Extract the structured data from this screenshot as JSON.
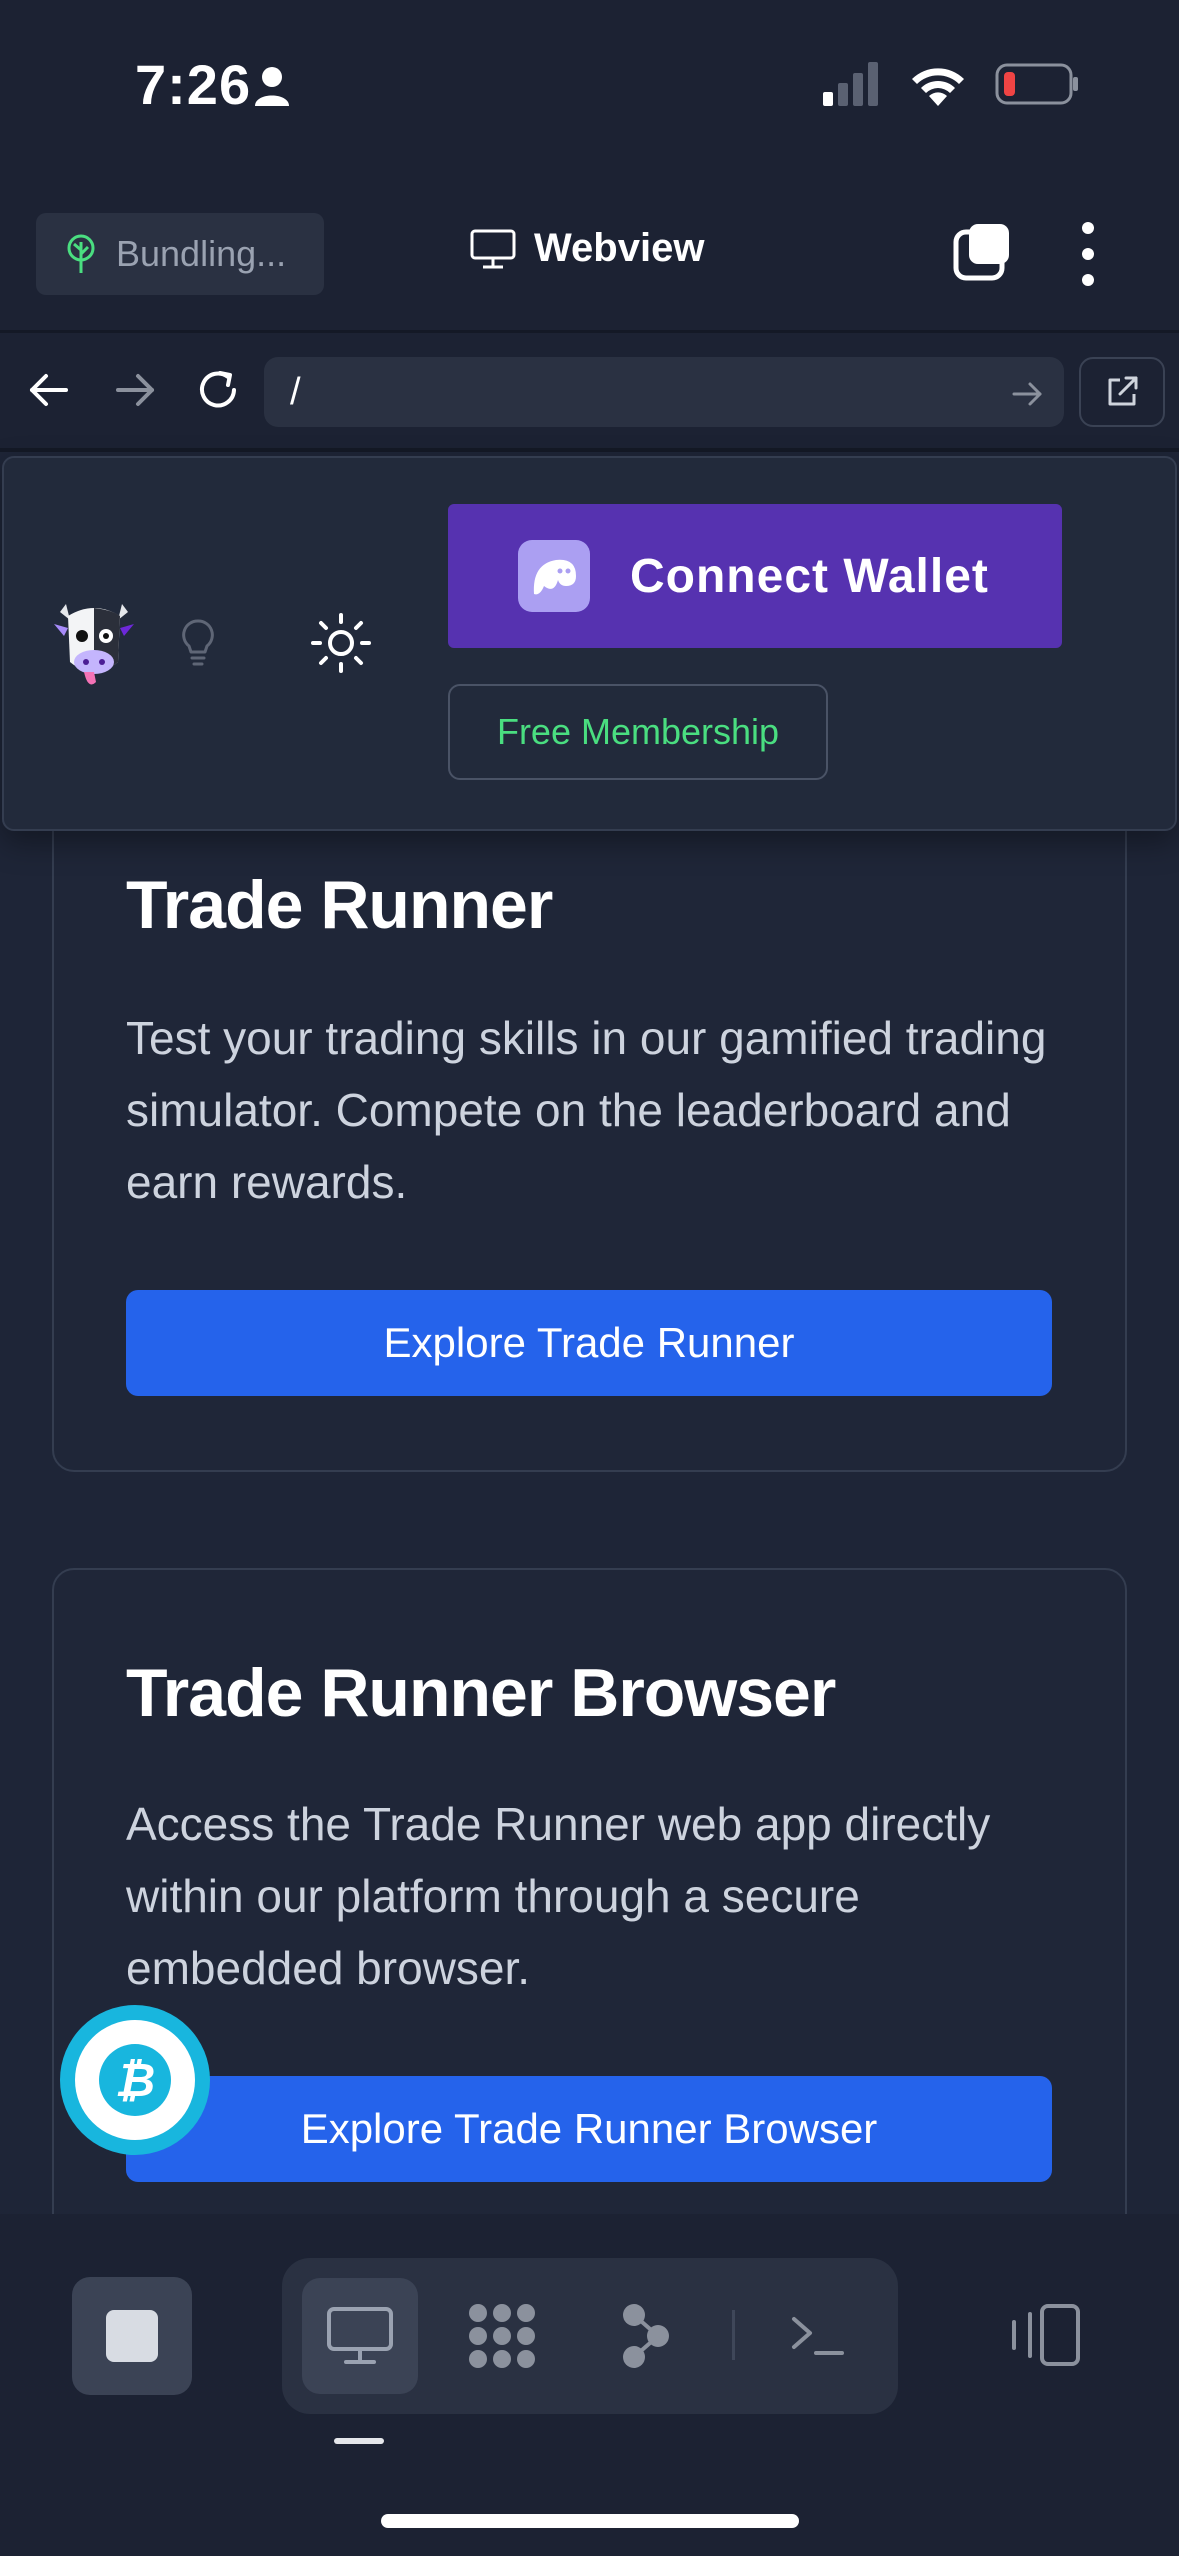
{
  "status_bar": {
    "time": "7:26"
  },
  "toolbar": {
    "bundling_label": "Bundling...",
    "title": "Webview"
  },
  "url_bar": {
    "value": "/"
  },
  "header": {
    "connect_wallet_label": "Connect Wallet",
    "free_membership_label": "Free Membership"
  },
  "cards": [
    {
      "title": "Trade Runner",
      "description": "Test your trading skills in our gamified trading simulator. Compete on the leaderboard and earn rewards.",
      "button_label": "Explore Trade Runner"
    },
    {
      "title": "Trade Runner Browser",
      "description": "Access the Trade Runner web app directly within our platform through a secure embedded browser.",
      "button_label": "Explore Trade Runner Browser"
    }
  ],
  "fab": {
    "glyph": "₿"
  },
  "icons": {
    "person": "person-icon",
    "signal": "cellular-signal-icon",
    "wifi": "wifi-icon",
    "battery": "battery-low-icon",
    "tree": "tree-icon",
    "monitor": "monitor-icon",
    "tabs": "tabs-icon",
    "more": "more-vertical-icon",
    "back": "arrow-left-icon",
    "forward": "arrow-right-icon",
    "reload": "reload-icon",
    "external": "external-link-icon",
    "bulb": "lightbulb-icon",
    "sun": "sun-icon",
    "phantom": "phantom-ghost-icon",
    "stop": "stop-icon",
    "modules": "modules-icon",
    "graph": "graph-icon",
    "terminal": "terminal-icon",
    "layout": "layout-icon"
  },
  "colors": {
    "background": "#1c2233",
    "accent_blue": "#2563eb",
    "wallet_purple": "#5632b0",
    "membership_green": "#4ade80",
    "battery_red": "#ef4444",
    "fab_cyan": "#18b6de"
  }
}
